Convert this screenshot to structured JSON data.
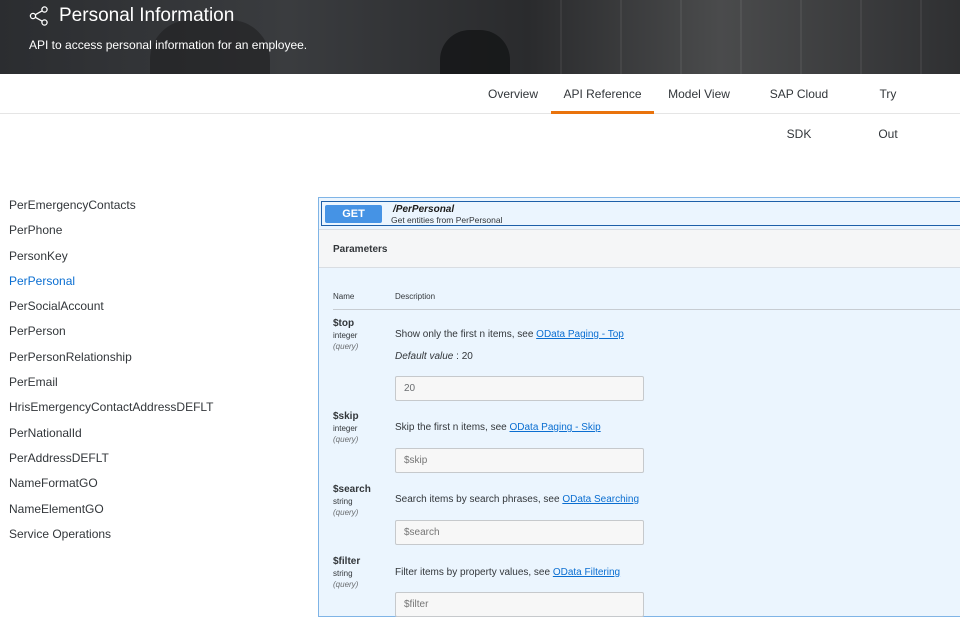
{
  "header": {
    "title": "Personal Information",
    "subtitle": "API to access personal information for an employee."
  },
  "tabs": [
    {
      "label": "Overview"
    },
    {
      "label": "API Reference",
      "active": true
    },
    {
      "label": "Model View"
    },
    {
      "label": "SAP Cloud SDK"
    },
    {
      "label": "Try Out"
    }
  ],
  "sidebar": {
    "items": [
      {
        "label": "PerEmergencyContacts"
      },
      {
        "label": "PerPhone"
      },
      {
        "label": "PersonKey"
      },
      {
        "label": "PerPersonal",
        "active": true
      },
      {
        "label": "PerSocialAccount"
      },
      {
        "label": "PerPerson"
      },
      {
        "label": "PerPersonRelationship"
      },
      {
        "label": "PerEmail"
      },
      {
        "label": "HrisEmergencyContactAddressDEFLT"
      },
      {
        "label": "PerNationalId"
      },
      {
        "label": "PerAddressDEFLT"
      },
      {
        "label": "NameFormatGO"
      },
      {
        "label": "NameElementGO"
      },
      {
        "label": "Service Operations"
      }
    ]
  },
  "operation": {
    "method": "GET",
    "path": "/PerPersonal",
    "description": "Get entities from PerPersonal",
    "parameters_title": "Parameters",
    "columns": {
      "name": "Name",
      "description": "Description"
    },
    "params": [
      {
        "name": "$top",
        "type": "integer",
        "in": "(query)",
        "text": "Show only the first n items, see ",
        "link": "OData Paging - Top",
        "default_label": "Default value",
        "default_sep": " : 20",
        "value": "20",
        "placeholder": "20"
      },
      {
        "name": "$skip",
        "type": "integer",
        "in": "(query)",
        "text": "Skip the first n items, see ",
        "link": "OData Paging - Skip",
        "value": "",
        "placeholder": "$skip"
      },
      {
        "name": "$search",
        "type": "string",
        "in": "(query)",
        "text": "Search items by search phrases, see ",
        "link": "OData Searching",
        "value": "",
        "placeholder": "$search"
      },
      {
        "name": "$filter",
        "type": "string",
        "in": "(query)",
        "text": "Filter items by property values, see ",
        "link": "OData Filtering",
        "value": "",
        "placeholder": "$filter"
      }
    ]
  },
  "colors": {
    "accent": "#e9730c",
    "link": "#0a6ed1",
    "get_badge": "#4593e5",
    "panel_bg": "#ebf5fe"
  },
  "icons": {
    "header": "share-icon"
  }
}
